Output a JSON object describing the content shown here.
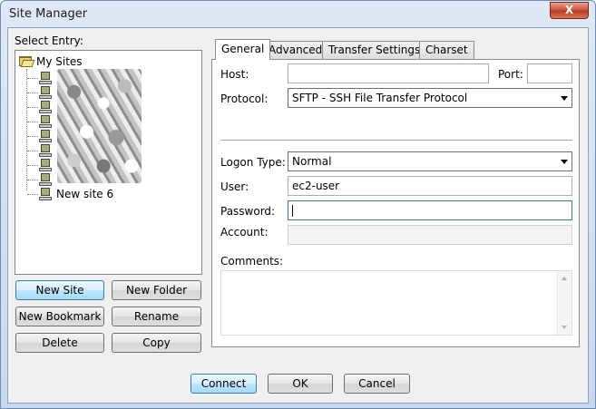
{
  "window": {
    "title": "Site Manager",
    "close_label": "X"
  },
  "left_panel": {
    "select_entry_label": "Select Entry:",
    "root_label": "My Sites",
    "sites_visible": [
      "New site 6"
    ],
    "buttons": {
      "new_site": "New Site",
      "new_folder": "New Folder",
      "new_bookmark": "New Bookmark",
      "rename": "Rename",
      "delete": "Delete",
      "copy": "Copy"
    }
  },
  "tabs": [
    "General",
    "Advanced",
    "Transfer Settings",
    "Charset"
  ],
  "general": {
    "host_label": "Host:",
    "host_value": "",
    "port_label": "Port:",
    "port_value": "",
    "protocol_label": "Protocol:",
    "protocol_value": "SFTP - SSH File Transfer Protocol",
    "logon_type_label": "Logon Type:",
    "logon_type_value": "Normal",
    "user_label": "User:",
    "user_value": "ec2-user",
    "password_label": "Password:",
    "password_value": "",
    "account_label": "Account:",
    "account_value": "",
    "comments_label": "Comments:",
    "comments_value": ""
  },
  "footer": {
    "connect": "Connect",
    "ok": "OK",
    "cancel": "Cancel"
  },
  "icons": {
    "folder": "folder-open-icon",
    "site": "computer-icon",
    "dropdown": "chevron-down-icon"
  }
}
